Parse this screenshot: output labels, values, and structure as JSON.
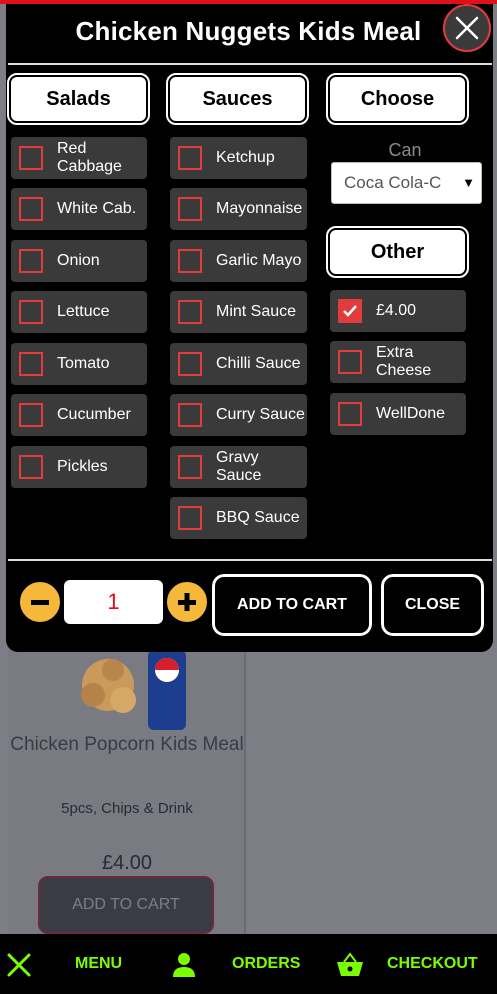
{
  "modal": {
    "title": "Chicken Nuggets Kids Meal",
    "categories": {
      "salads": "Salads",
      "sauces": "Sauces",
      "choose": "Choose",
      "other": "Other"
    },
    "salads": [
      {
        "label": "Red Cabbage",
        "checked": false
      },
      {
        "label": "White Cab.",
        "checked": false
      },
      {
        "label": "Onion",
        "checked": false
      },
      {
        "label": "Lettuce",
        "checked": false
      },
      {
        "label": "Tomato",
        "checked": false
      },
      {
        "label": "Cucumber",
        "checked": false
      },
      {
        "label": "Pickles",
        "checked": false
      }
    ],
    "sauces": [
      {
        "label": "Ketchup",
        "checked": false
      },
      {
        "label": "Mayonnaise",
        "checked": false
      },
      {
        "label": "Garlic Mayo",
        "checked": false
      },
      {
        "label": "Mint Sauce",
        "checked": false
      },
      {
        "label": "Chilli Sauce",
        "checked": false
      },
      {
        "label": "Curry Sauce",
        "checked": false
      },
      {
        "label": "Gravy Sauce",
        "checked": false
      },
      {
        "label": "BBQ Sauce",
        "checked": false
      }
    ],
    "choose": {
      "can_label": "Can",
      "can_value": "Coca Cola-C"
    },
    "other": [
      {
        "label": "£4.00",
        "checked": true
      },
      {
        "label": "Extra Cheese",
        "checked": false
      },
      {
        "label": "WellDone",
        "checked": false
      }
    ],
    "quantity": "1",
    "add_to_cart": "ADD TO CART",
    "close": "CLOSE"
  },
  "background": {
    "product_title": "Chicken Popcorn Kids Meal",
    "product_desc": "5pcs, Chips & Drink",
    "product_price": "£4.00",
    "add_to_cart": "ADD TO CART"
  },
  "bottom_nav": {
    "menu": "MENU",
    "orders": "ORDERS",
    "checkout": "CHECKOUT"
  },
  "colors": {
    "accent_red": "#e23b3b",
    "nav_green": "#7cfc00",
    "qty_orange": "#f6b83b"
  }
}
